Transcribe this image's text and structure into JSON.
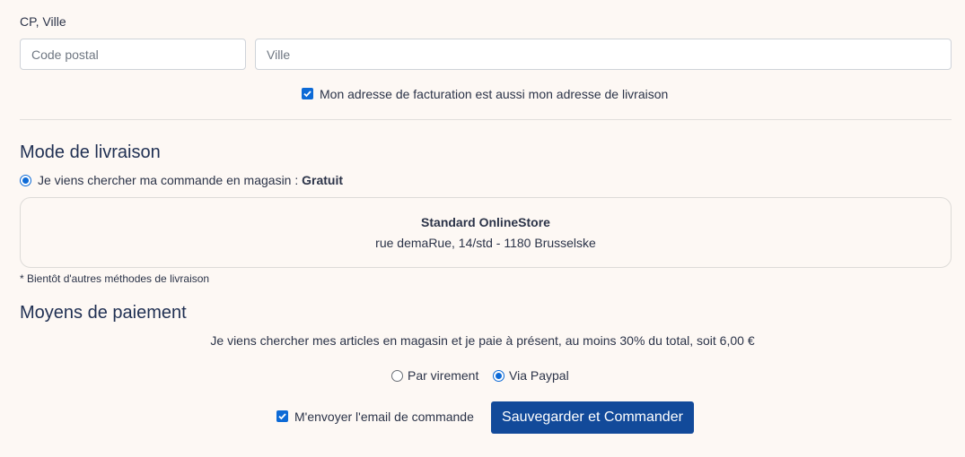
{
  "address": {
    "label": "CP, Ville",
    "postal_placeholder": "Code postal",
    "city_placeholder": "Ville",
    "same_address_label": "Mon adresse de facturation est aussi mon adresse de livraison",
    "same_address_checked": true
  },
  "delivery": {
    "title": "Mode de livraison",
    "option_text": "Je viens chercher ma commande en magasin :",
    "option_price": "Gratuit",
    "store_name": "Standard OnlineStore",
    "store_address": "rue demaRue, 14/std - 1180 Brusselske",
    "note": "* Bientôt d'autres méthodes de livraison"
  },
  "payment": {
    "title": "Moyens de paiement",
    "info": "Je viens chercher mes articles en magasin et je paie à présent, au moins 30% du total, soit 6,00 €",
    "options": [
      {
        "label": "Par virement",
        "selected": false
      },
      {
        "label": "Via Paypal",
        "selected": true
      }
    ],
    "email_label": "M'envoyer l'email de commande",
    "email_checked": true,
    "submit_label": "Sauvegarder et Commander"
  },
  "colors": {
    "background": "#fdf8f4",
    "accent": "#0d6ad6",
    "primary_button": "#124a9a",
    "heading": "#1f2f52"
  }
}
